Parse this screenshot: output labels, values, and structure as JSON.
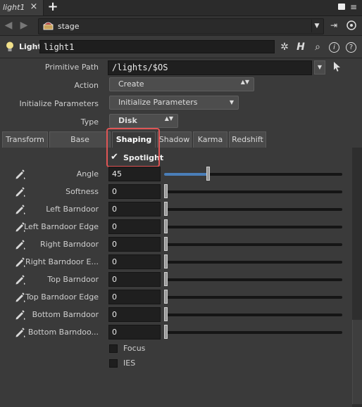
{
  "window": {
    "tab_title": "light1",
    "tab_close": "×",
    "add_tab": "+",
    "menu_glyph": "≡"
  },
  "pathbar": {
    "back_glyph": "◀",
    "forward_glyph": "▶",
    "path": "stage",
    "dropdown_glyph": "▼",
    "pin_glyph": "⇥"
  },
  "node": {
    "type": "Light",
    "name": "light1",
    "gear_glyph": "✲",
    "houdini_glyph": "H",
    "search_glyph": "⌕",
    "info_glyph": "i",
    "help_glyph": "?"
  },
  "params": {
    "primitive_path_label": "Primitive Path",
    "primitive_path_value": "/lights/$OS",
    "action_label": "Action",
    "action_value": "Create",
    "init_label": "Initialize Parameters",
    "init_value": "Initialize Parameters",
    "type_label": "Type",
    "type_value": "Disk",
    "updown_glyph": "▲▼",
    "down_glyph": "▼"
  },
  "folder_tabs": [
    "Transform",
    "Base Properties",
    "Shaping",
    "Shadow",
    "Karma",
    "Redshift"
  ],
  "active_tab": "Shaping",
  "shaping": {
    "spotlight_label": "Spotlight",
    "spotlight_checked": true,
    "check_glyph": "✔",
    "rows": [
      {
        "label": "Angle",
        "value": "45",
        "fraction": 0.25
      },
      {
        "label": "Softness",
        "value": "0",
        "fraction": 0
      },
      {
        "label": "Left Barndoor",
        "value": "0",
        "fraction": 0
      },
      {
        "label": "Left Barndoor Edge",
        "value": "0",
        "fraction": 0
      },
      {
        "label": "Right Barndoor",
        "value": "0",
        "fraction": 0
      },
      {
        "label": "Right Barndoor E...",
        "value": "0",
        "fraction": 0
      },
      {
        "label": "Top Barndoor",
        "value": "0",
        "fraction": 0
      },
      {
        "label": "Top Barndoor Edge",
        "value": "0",
        "fraction": 0
      },
      {
        "label": "Bottom Barndoor",
        "value": "0",
        "fraction": 0
      },
      {
        "label": "Bottom Barndoo...",
        "value": "0",
        "fraction": 0
      }
    ],
    "focus_label": "Focus",
    "ies_label": "IES"
  },
  "colors": {
    "accent": "#4a7eb8",
    "highlight": "#e05555",
    "background": "#3a3a3a"
  }
}
